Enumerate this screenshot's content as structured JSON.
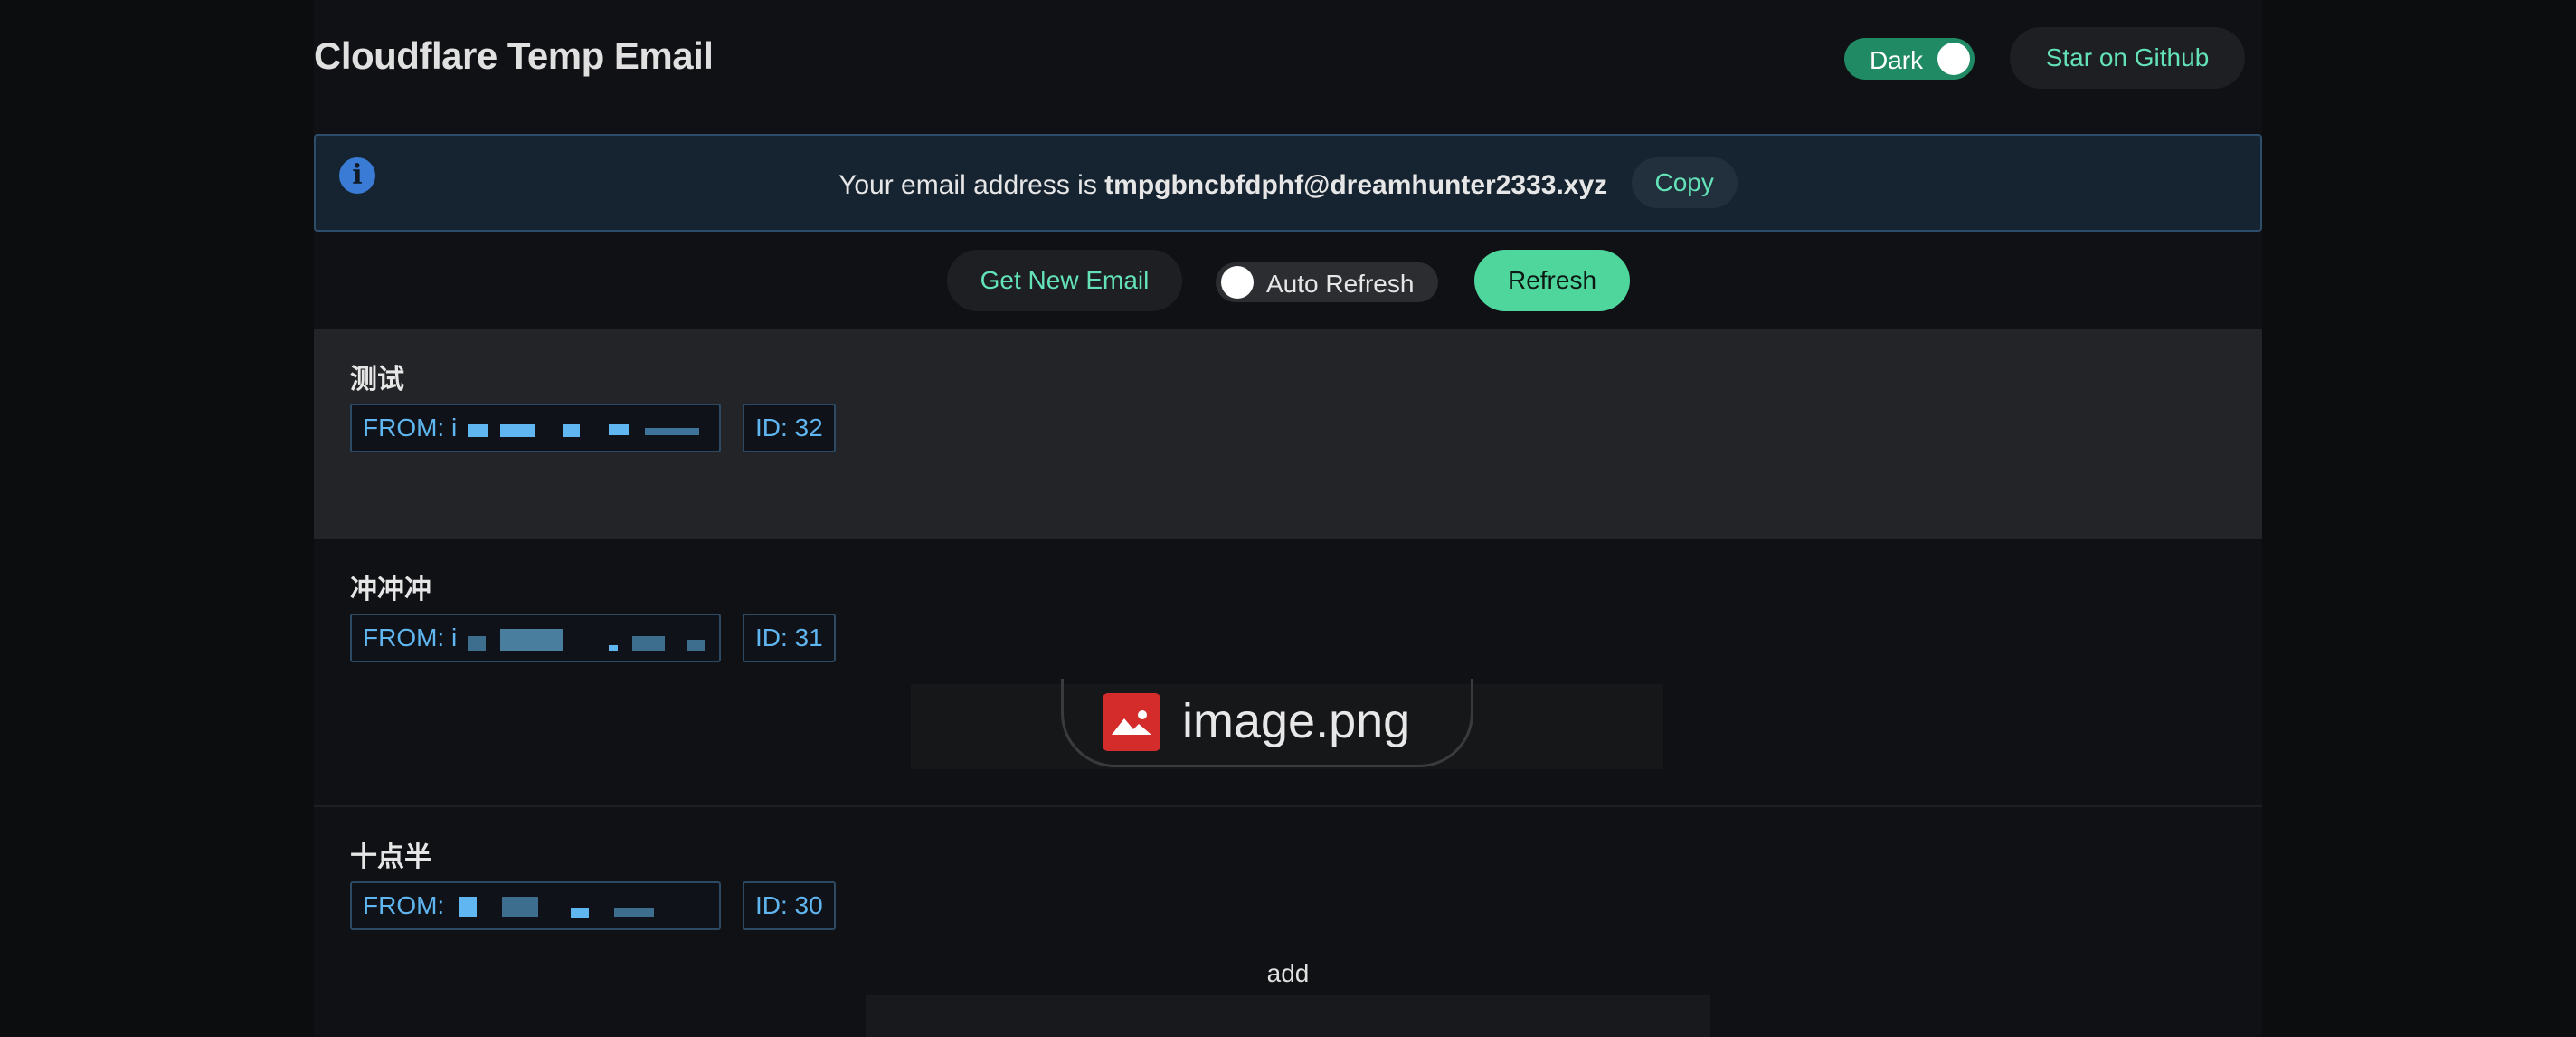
{
  "header": {
    "title": "Cloudflare Temp Email",
    "theme_toggle_label": "Dark",
    "theme_toggle_on": true,
    "star_label": "Star on Github"
  },
  "alert": {
    "prefix": "Your email address is",
    "address": "tmpgbncbfdphf@dreamhunter2333.xyz",
    "copy_label": "Copy"
  },
  "actions": {
    "get_new_label": "Get New Email",
    "auto_refresh_label": "Auto Refresh",
    "auto_refresh_on": false,
    "refresh_label": "Refresh"
  },
  "mails": [
    {
      "subject": "测试",
      "from_prefix": "FROM: i",
      "id_label": "ID: 32"
    },
    {
      "subject": "冲冲冲",
      "from_prefix": "FROM: i",
      "id_label": "ID: 31",
      "attachment": "image.png"
    },
    {
      "subject": "十点半",
      "from_prefix": "FROM:",
      "id_label": "ID: 30",
      "body": "add"
    }
  ],
  "colors": {
    "accent": "#63e2b7",
    "tag_text": "#5fb6f0",
    "alert_bg": "#162330"
  },
  "icons": {
    "info": "info-circle-icon",
    "attachment": "image-file-icon"
  }
}
